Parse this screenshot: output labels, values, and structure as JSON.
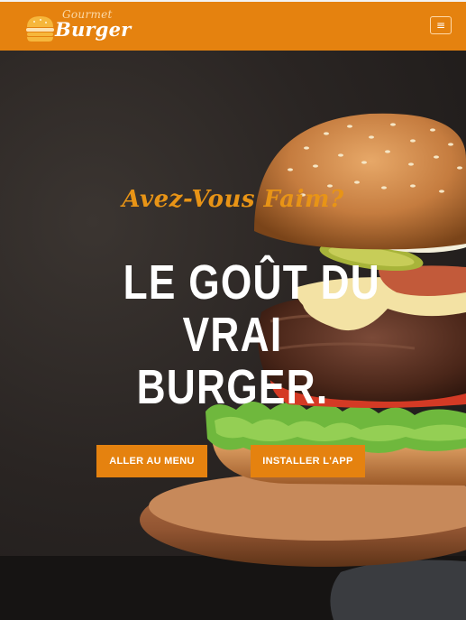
{
  "brand": {
    "logo_top": "Gourmet",
    "logo_bottom": "Burger"
  },
  "nav": {
    "menu_icon": "hamburger-menu-icon",
    "menu_glyph": "≡"
  },
  "hero": {
    "tagline": "Avez-Vous Faim?",
    "headline_lines": [
      "LE GOÛT DU",
      "VRAI",
      "BURGER."
    ],
    "buttons": {
      "menu": "ALLER AU MENU",
      "app": "INSTALLER L'APP"
    }
  },
  "colors": {
    "accent": "#e5820f",
    "tagline": "#e89416",
    "background": "#1e1b1a"
  }
}
